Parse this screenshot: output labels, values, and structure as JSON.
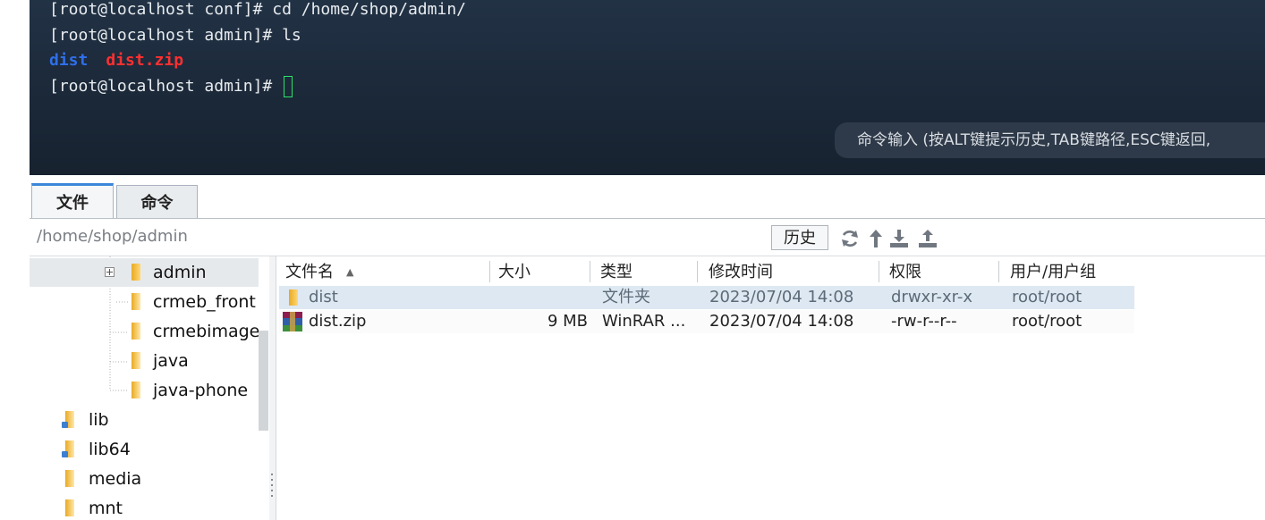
{
  "terminal": {
    "lines": [
      "[root@localhost conf]# cd /home/shop/admin/",
      "[root@localhost admin]# ls"
    ],
    "ls_output": {
      "dir": "dist",
      "zip": "dist.zip"
    },
    "prompt": "[root@localhost admin]#",
    "command_hint": "命令输入 (按ALT键提示历史,TAB键路径,ESC键返回,"
  },
  "tabs": {
    "file": "文件",
    "command": "命令"
  },
  "pathbar": {
    "path": "/home/shop/admin",
    "history": "历史"
  },
  "tree": {
    "items": [
      "admin",
      "crmeb_front",
      "crmebimage",
      "java",
      "java-phone",
      "lib",
      "lib64",
      "media",
      "mnt"
    ]
  },
  "filelist": {
    "columns": [
      "文件名",
      "大小",
      "类型",
      "修改时间",
      "权限",
      "用户/用户组"
    ],
    "rows": [
      {
        "name": "dist",
        "size": "",
        "type": "文件夹",
        "modified": "2023/07/04 14:08",
        "perm": "drwxr-xr-x",
        "owner": "root/root"
      },
      {
        "name": "dist.zip",
        "size": "9 MB",
        "type": "WinRAR ...",
        "modified": "2023/07/04 14:08",
        "perm": "-rw-r--r--",
        "owner": "root/root"
      }
    ]
  },
  "colors": {
    "terminal_bg": "#1c2a3b",
    "dir_color": "#2f6fe8",
    "zip_color": "#ff3030",
    "cursor_color": "#2ee06a",
    "tab_accent": "#3b86d9",
    "selection_row": "#dde8f2"
  },
  "icons": {
    "refresh": "refresh-icon",
    "up": "up-arrow-icon",
    "download": "download-icon",
    "upload": "upload-icon",
    "folder": "folder-icon",
    "archive": "winrar-icon"
  }
}
